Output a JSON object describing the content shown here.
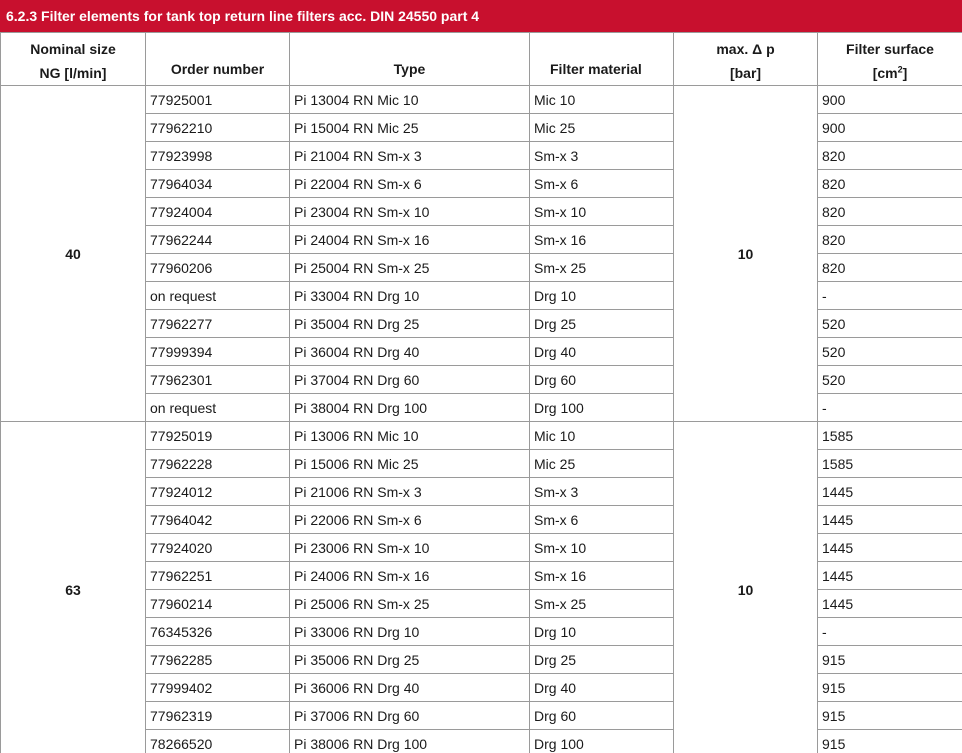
{
  "title": "6.2.3 Filter elements for tank top return line filters acc. DIN 24550 part 4",
  "header": {
    "nominal_size_line1": "Nominal size",
    "nominal_size_line2": "NG [l/min]",
    "order_number": "Order number",
    "type": "Type",
    "filter_material": "Filter material",
    "max_dp_line1": "max. Δ p",
    "max_dp_line2": "[bar]",
    "filter_surface_line1": "Filter surface",
    "filter_surface_line2_prefix": "[cm",
    "filter_surface_line2_sup": "2",
    "filter_surface_line2_suffix": "]"
  },
  "groups": [
    {
      "nominal_size": "40",
      "max_dp": "10",
      "rows": [
        {
          "order": "77925001",
          "type": "Pi 13004 RN Mic 10",
          "material": "Mic 10",
          "surface": "900"
        },
        {
          "order": "77962210",
          "type": "Pi 15004 RN Mic 25",
          "material": "Mic 25",
          "surface": "900"
        },
        {
          "order": "77923998",
          "type": "Pi 21004 RN Sm-x 3",
          "material": "Sm-x 3",
          "surface": "820"
        },
        {
          "order": "77964034",
          "type": "Pi 22004 RN Sm-x 6",
          "material": "Sm-x 6",
          "surface": "820"
        },
        {
          "order": "77924004",
          "type": "Pi 23004 RN Sm-x 10",
          "material": "Sm-x 10",
          "surface": "820"
        },
        {
          "order": "77962244",
          "type": "Pi 24004 RN Sm-x 16",
          "material": "Sm-x 16",
          "surface": "820"
        },
        {
          "order": "77960206",
          "type": "Pi 25004 RN Sm-x 25",
          "material": "Sm-x 25",
          "surface": "820"
        },
        {
          "order": "on request",
          "type": "Pi 33004 RN Drg 10",
          "material": "Drg 10",
          "surface": "-"
        },
        {
          "order": "77962277",
          "type": "Pi 35004 RN Drg 25",
          "material": "Drg 25",
          "surface": "520"
        },
        {
          "order": "77999394",
          "type": "Pi 36004 RN Drg 40",
          "material": "Drg 40",
          "surface": "520"
        },
        {
          "order": "77962301",
          "type": "Pi 37004 RN Drg 60",
          "material": "Drg 60",
          "surface": "520"
        },
        {
          "order": "on request",
          "type": "Pi 38004 RN Drg 100",
          "material": "Drg 100",
          "surface": "-"
        }
      ]
    },
    {
      "nominal_size": "63",
      "max_dp": "10",
      "rows": [
        {
          "order": "77925019",
          "type": "Pi 13006 RN Mic 10",
          "material": "Mic 10",
          "surface": "1585"
        },
        {
          "order": "77962228",
          "type": "Pi 15006 RN Mic 25",
          "material": "Mic 25",
          "surface": "1585"
        },
        {
          "order": "77924012",
          "type": "Pi 21006 RN Sm-x 3",
          "material": "Sm-x 3",
          "surface": "1445"
        },
        {
          "order": "77964042",
          "type": "Pi 22006 RN Sm-x 6",
          "material": "Sm-x 6",
          "surface": "1445"
        },
        {
          "order": "77924020",
          "type": "Pi 23006 RN Sm-x 10",
          "material": "Sm-x 10",
          "surface": "1445"
        },
        {
          "order": "77962251",
          "type": "Pi 24006 RN Sm-x 16",
          "material": "Sm-x 16",
          "surface": "1445"
        },
        {
          "order": "77960214",
          "type": "Pi 25006 RN Sm-x 25",
          "material": "Sm-x 25",
          "surface": "1445"
        },
        {
          "order": "76345326",
          "type": "Pi 33006 RN Drg 10",
          "material": "Drg 10",
          "surface": "-"
        },
        {
          "order": "77962285",
          "type": "Pi 35006 RN Drg 25",
          "material": "Drg 25",
          "surface": "915"
        },
        {
          "order": "77999402",
          "type": "Pi 36006 RN Drg 40",
          "material": "Drg 40",
          "surface": "915"
        },
        {
          "order": "77962319",
          "type": "Pi 37006 RN Drg 60",
          "material": "Drg 60",
          "surface": "915"
        },
        {
          "order": "78266520",
          "type": "Pi 38006 RN Drg 100",
          "material": "Drg 100",
          "surface": "915"
        }
      ]
    }
  ],
  "colors": {
    "title_background": "#c8102e",
    "title_text": "#ffffff",
    "grid_line": "#9a9a9a"
  }
}
